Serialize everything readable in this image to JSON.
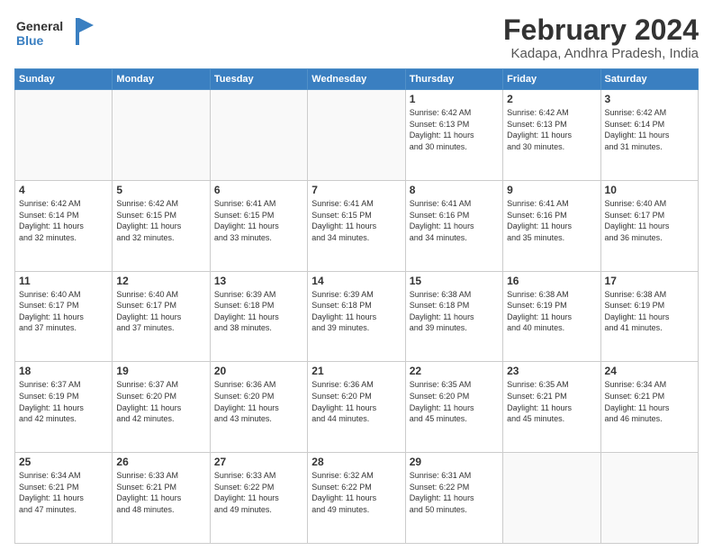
{
  "logo": {
    "line1": "General",
    "line2": "Blue"
  },
  "title": "February 2024",
  "location": "Kadapa, Andhra Pradesh, India",
  "weekdays": [
    "Sunday",
    "Monday",
    "Tuesday",
    "Wednesday",
    "Thursday",
    "Friday",
    "Saturday"
  ],
  "weeks": [
    [
      {
        "day": "",
        "info": ""
      },
      {
        "day": "",
        "info": ""
      },
      {
        "day": "",
        "info": ""
      },
      {
        "day": "",
        "info": ""
      },
      {
        "day": "1",
        "info": "Sunrise: 6:42 AM\nSunset: 6:13 PM\nDaylight: 11 hours\nand 30 minutes."
      },
      {
        "day": "2",
        "info": "Sunrise: 6:42 AM\nSunset: 6:13 PM\nDaylight: 11 hours\nand 30 minutes."
      },
      {
        "day": "3",
        "info": "Sunrise: 6:42 AM\nSunset: 6:14 PM\nDaylight: 11 hours\nand 31 minutes."
      }
    ],
    [
      {
        "day": "4",
        "info": "Sunrise: 6:42 AM\nSunset: 6:14 PM\nDaylight: 11 hours\nand 32 minutes."
      },
      {
        "day": "5",
        "info": "Sunrise: 6:42 AM\nSunset: 6:15 PM\nDaylight: 11 hours\nand 32 minutes."
      },
      {
        "day": "6",
        "info": "Sunrise: 6:41 AM\nSunset: 6:15 PM\nDaylight: 11 hours\nand 33 minutes."
      },
      {
        "day": "7",
        "info": "Sunrise: 6:41 AM\nSunset: 6:15 PM\nDaylight: 11 hours\nand 34 minutes."
      },
      {
        "day": "8",
        "info": "Sunrise: 6:41 AM\nSunset: 6:16 PM\nDaylight: 11 hours\nand 34 minutes."
      },
      {
        "day": "9",
        "info": "Sunrise: 6:41 AM\nSunset: 6:16 PM\nDaylight: 11 hours\nand 35 minutes."
      },
      {
        "day": "10",
        "info": "Sunrise: 6:40 AM\nSunset: 6:17 PM\nDaylight: 11 hours\nand 36 minutes."
      }
    ],
    [
      {
        "day": "11",
        "info": "Sunrise: 6:40 AM\nSunset: 6:17 PM\nDaylight: 11 hours\nand 37 minutes."
      },
      {
        "day": "12",
        "info": "Sunrise: 6:40 AM\nSunset: 6:17 PM\nDaylight: 11 hours\nand 37 minutes."
      },
      {
        "day": "13",
        "info": "Sunrise: 6:39 AM\nSunset: 6:18 PM\nDaylight: 11 hours\nand 38 minutes."
      },
      {
        "day": "14",
        "info": "Sunrise: 6:39 AM\nSunset: 6:18 PM\nDaylight: 11 hours\nand 39 minutes."
      },
      {
        "day": "15",
        "info": "Sunrise: 6:38 AM\nSunset: 6:18 PM\nDaylight: 11 hours\nand 39 minutes."
      },
      {
        "day": "16",
        "info": "Sunrise: 6:38 AM\nSunset: 6:19 PM\nDaylight: 11 hours\nand 40 minutes."
      },
      {
        "day": "17",
        "info": "Sunrise: 6:38 AM\nSunset: 6:19 PM\nDaylight: 11 hours\nand 41 minutes."
      }
    ],
    [
      {
        "day": "18",
        "info": "Sunrise: 6:37 AM\nSunset: 6:19 PM\nDaylight: 11 hours\nand 42 minutes."
      },
      {
        "day": "19",
        "info": "Sunrise: 6:37 AM\nSunset: 6:20 PM\nDaylight: 11 hours\nand 42 minutes."
      },
      {
        "day": "20",
        "info": "Sunrise: 6:36 AM\nSunset: 6:20 PM\nDaylight: 11 hours\nand 43 minutes."
      },
      {
        "day": "21",
        "info": "Sunrise: 6:36 AM\nSunset: 6:20 PM\nDaylight: 11 hours\nand 44 minutes."
      },
      {
        "day": "22",
        "info": "Sunrise: 6:35 AM\nSunset: 6:20 PM\nDaylight: 11 hours\nand 45 minutes."
      },
      {
        "day": "23",
        "info": "Sunrise: 6:35 AM\nSunset: 6:21 PM\nDaylight: 11 hours\nand 45 minutes."
      },
      {
        "day": "24",
        "info": "Sunrise: 6:34 AM\nSunset: 6:21 PM\nDaylight: 11 hours\nand 46 minutes."
      }
    ],
    [
      {
        "day": "25",
        "info": "Sunrise: 6:34 AM\nSunset: 6:21 PM\nDaylight: 11 hours\nand 47 minutes."
      },
      {
        "day": "26",
        "info": "Sunrise: 6:33 AM\nSunset: 6:21 PM\nDaylight: 11 hours\nand 48 minutes."
      },
      {
        "day": "27",
        "info": "Sunrise: 6:33 AM\nSunset: 6:22 PM\nDaylight: 11 hours\nand 49 minutes."
      },
      {
        "day": "28",
        "info": "Sunrise: 6:32 AM\nSunset: 6:22 PM\nDaylight: 11 hours\nand 49 minutes."
      },
      {
        "day": "29",
        "info": "Sunrise: 6:31 AM\nSunset: 6:22 PM\nDaylight: 11 hours\nand 50 minutes."
      },
      {
        "day": "",
        "info": ""
      },
      {
        "day": "",
        "info": ""
      }
    ]
  ]
}
